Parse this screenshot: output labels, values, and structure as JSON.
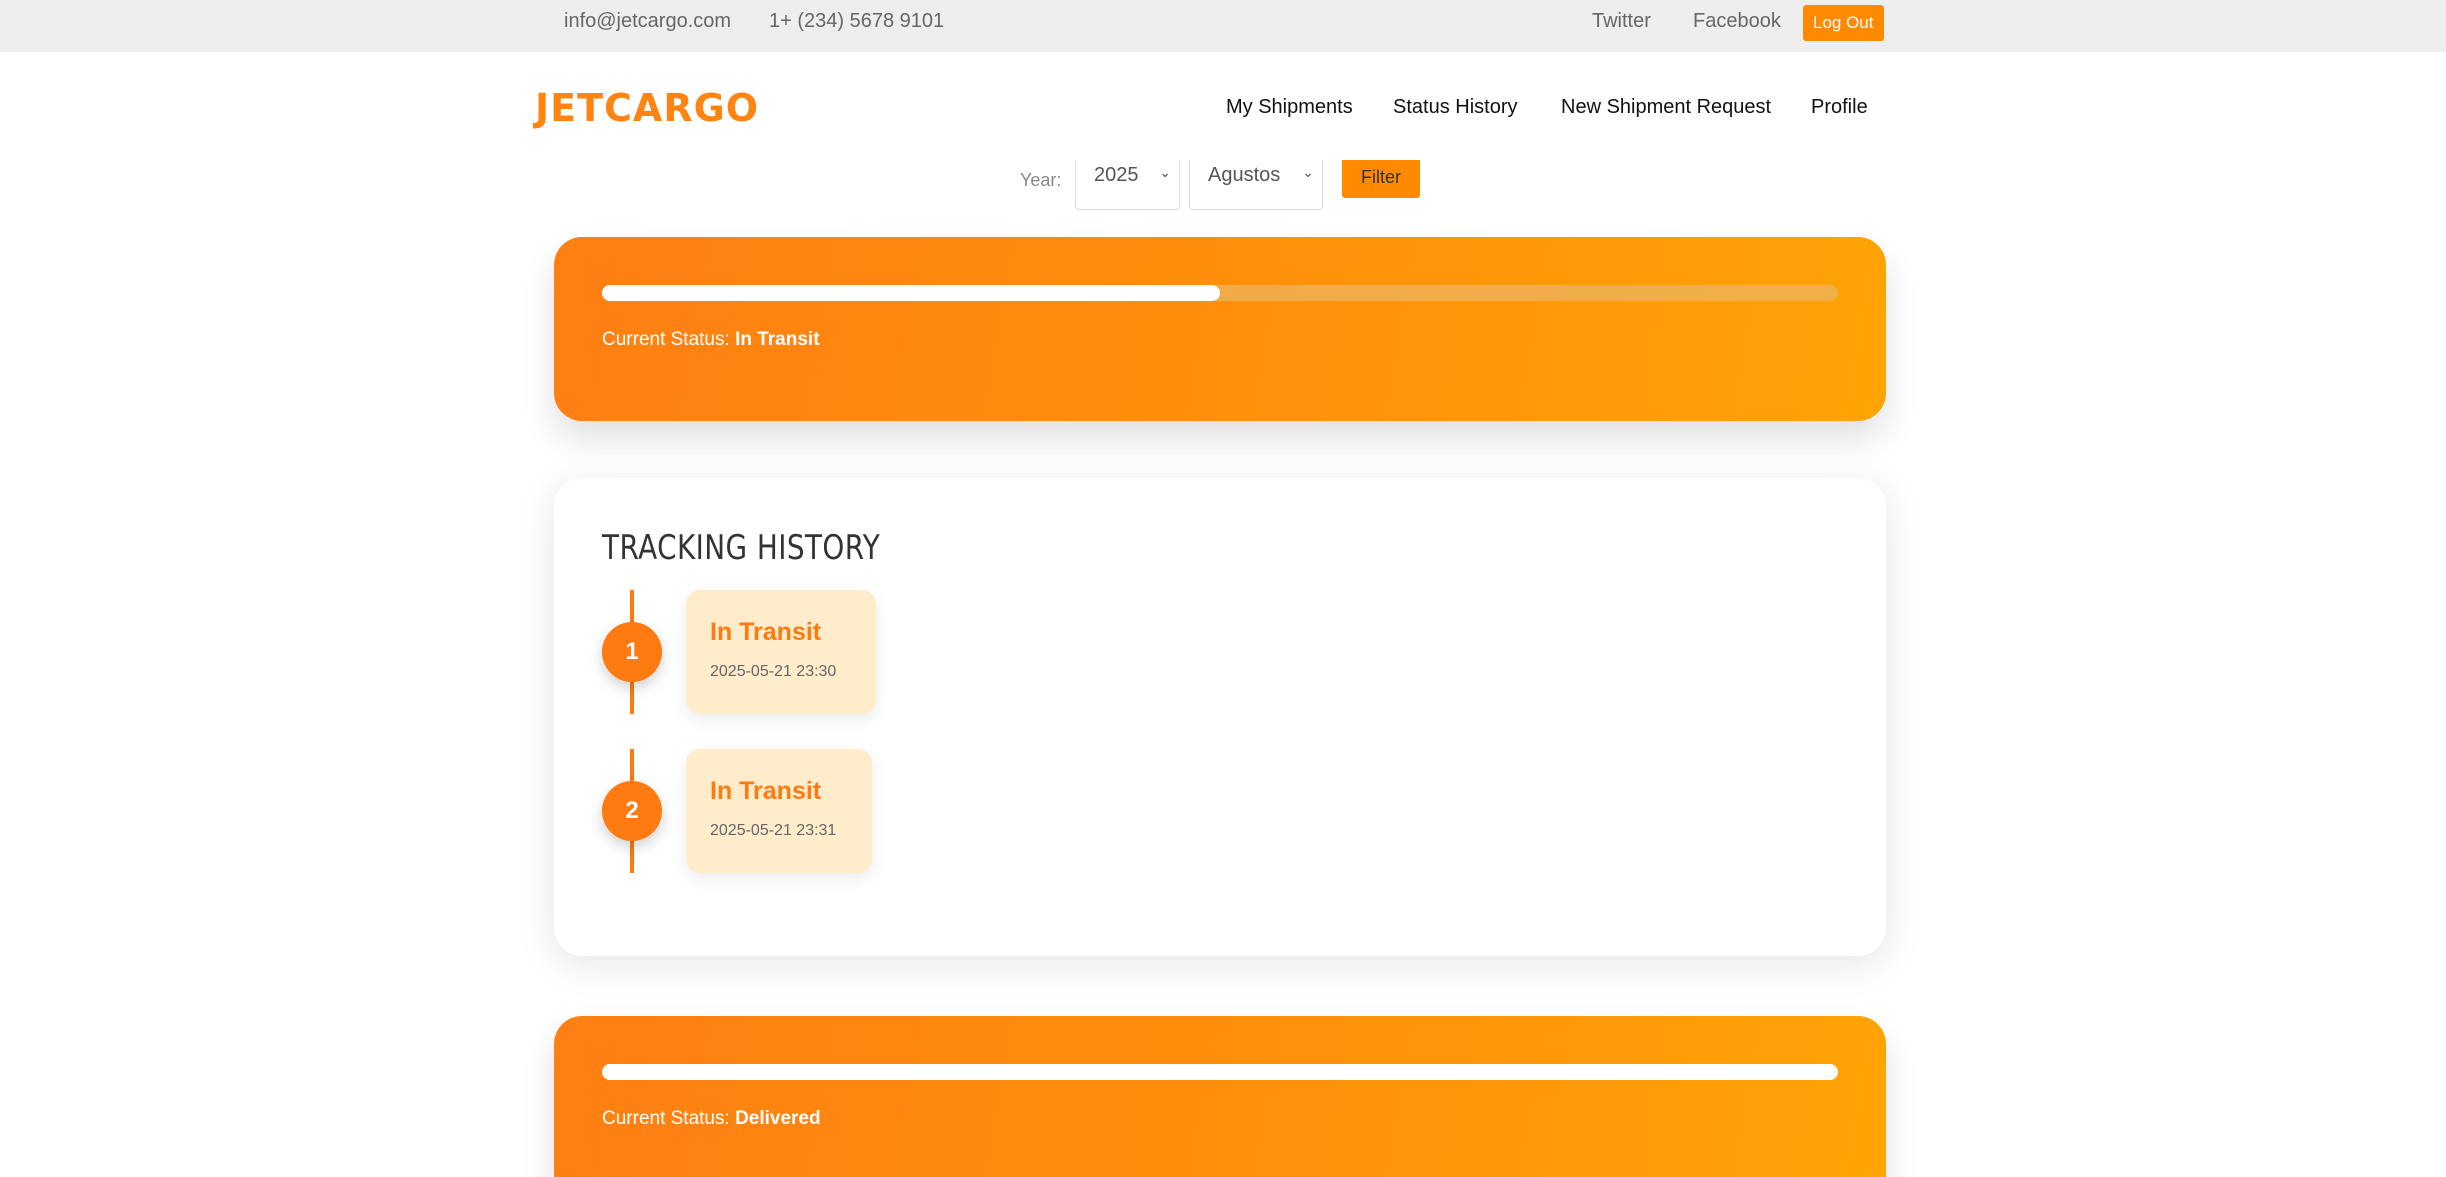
{
  "topbar": {
    "email": "info@jetcargo.com",
    "phone": "1+ (234) 5678 9101",
    "twitter": "Twitter",
    "facebook": "Facebook",
    "logout_label": "Log Out"
  },
  "header": {
    "logo": "JETCARGO",
    "nav": [
      "My Shipments",
      "Status History",
      "New Shipment Request",
      "Profile"
    ]
  },
  "filter": {
    "year_label": "Year:",
    "year_value": "2025",
    "month_value": "Agustos",
    "button_label": "Filter"
  },
  "shipments": [
    {
      "status_label": "Current Status:",
      "status": "In Transit",
      "progress_percent": 50
    },
    {
      "status_label": "Current Status:",
      "status": "Delivered",
      "progress_percent": 100
    }
  ],
  "tracking": {
    "title": "TRACKING HISTORY",
    "events": [
      {
        "step": "1",
        "status": "In Transit",
        "time": "2025-05-21 23:30"
      },
      {
        "step": "2",
        "status": "In Transit",
        "time": "2025-05-21 23:31"
      }
    ]
  },
  "colors": {
    "accent": "#ff8a00",
    "logo": "#ff8412",
    "card_gradient_start": "#ff7f13",
    "card_gradient_end": "#ffa405",
    "timeline_box": "#ffeccb"
  }
}
